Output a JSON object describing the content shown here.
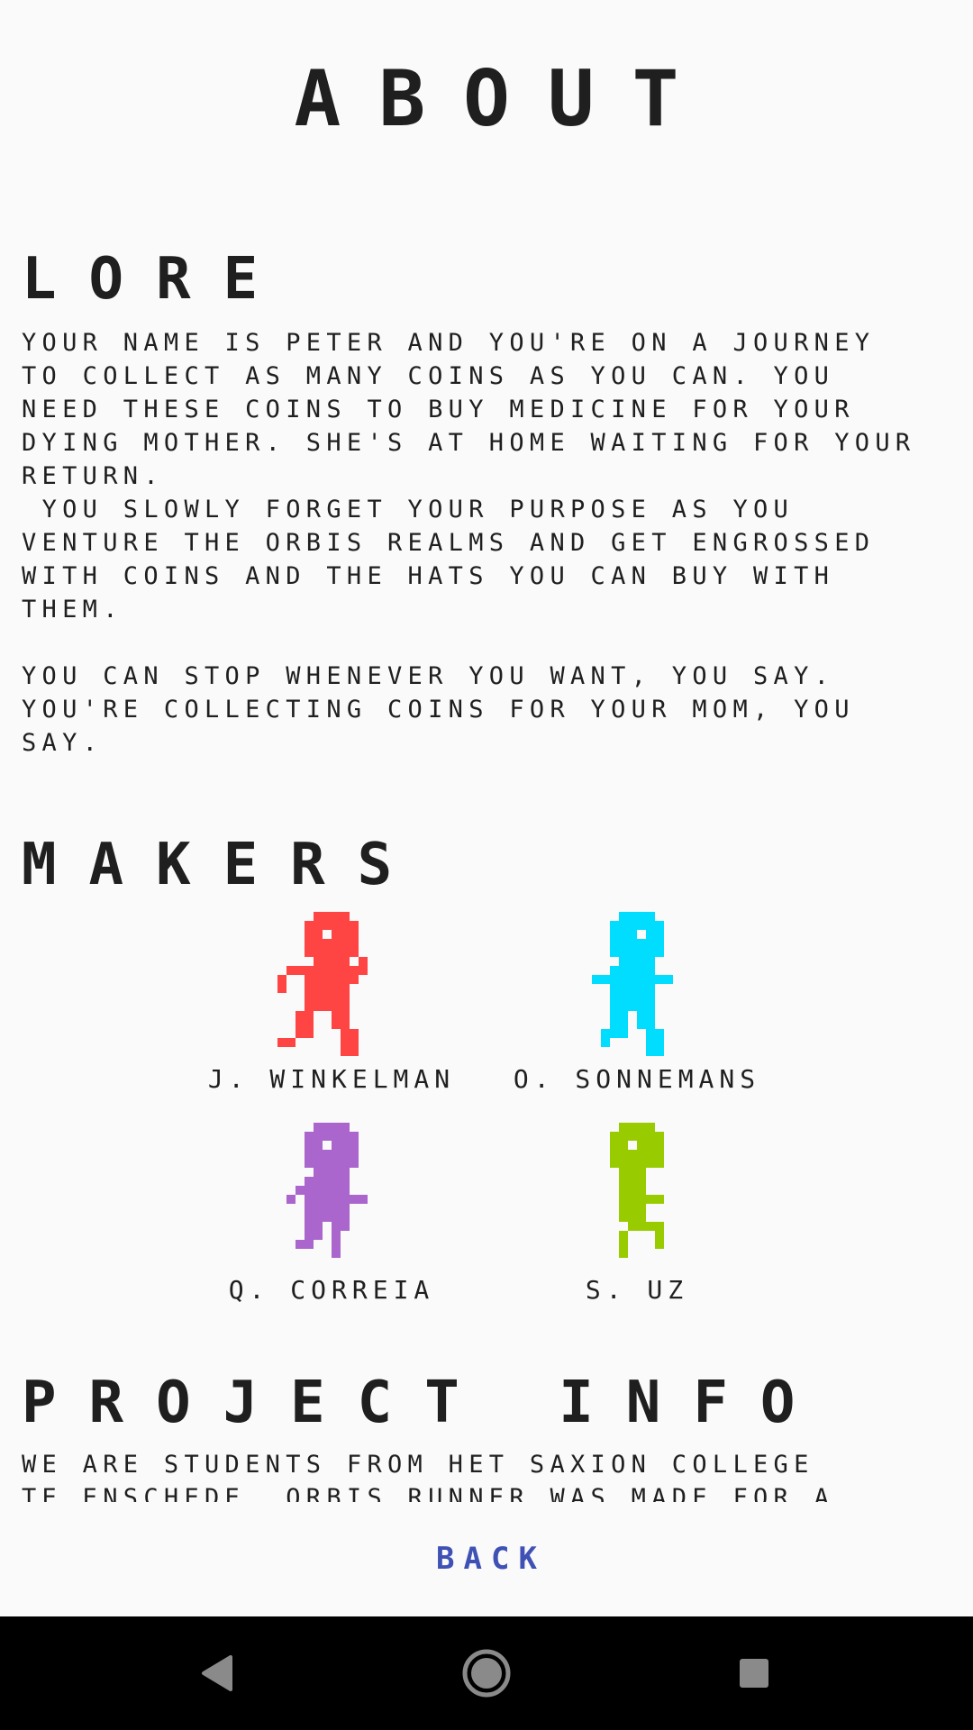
{
  "header": {
    "title": "ABOUT"
  },
  "lore": {
    "title": "LORE",
    "text": "YOUR NAME IS PETER AND YOU'RE ON A JOURNEY\nTO COLLECT AS MANY COINS AS YOU CAN. YOU\nNEED THESE COINS TO BUY MEDICINE FOR YOUR\nDYING MOTHER. SHE'S AT HOME WAITING FOR YOUR\nRETURN.\n YOU SLOWLY FORGET YOUR PURPOSE AS YOU\nVENTURE THE ORBIS REALMS AND GET ENGROSSED\nWITH COINS AND THE HATS YOU CAN BUY WITH\nTHEM.\n\nYOU CAN STOP WHENEVER YOU WANT, YOU SAY.\nYOU'RE COLLECTING COINS FOR YOUR MOM, YOU\nSAY."
  },
  "makers": {
    "title": "MAKERS",
    "people": [
      {
        "name": "J. WINKELMAN",
        "color": "#ff4444",
        "icon": "red-runner-sprite-icon"
      },
      {
        "name": "O. SONNEMANS",
        "color": "#00ddff",
        "icon": "cyan-runner-sprite-icon"
      },
      {
        "name": "Q. CORREIA",
        "color": "#aa66cc",
        "icon": "purple-runner-sprite-icon"
      },
      {
        "name": "S. UZ",
        "color": "#99cc00",
        "icon": "green-runner-sprite-icon"
      }
    ]
  },
  "project": {
    "title": "PROJECT INFO",
    "text": "WE ARE STUDENTS FROM HET SAXION COLLEGE\nTE ENSCHEDE. ORBIS RUNNER WAS MADE FOR A"
  },
  "back_label": "BACK",
  "nav": {
    "back_icon": "triangle-back-icon",
    "home_icon": "circle-home-icon",
    "recents_icon": "square-recents-icon"
  }
}
